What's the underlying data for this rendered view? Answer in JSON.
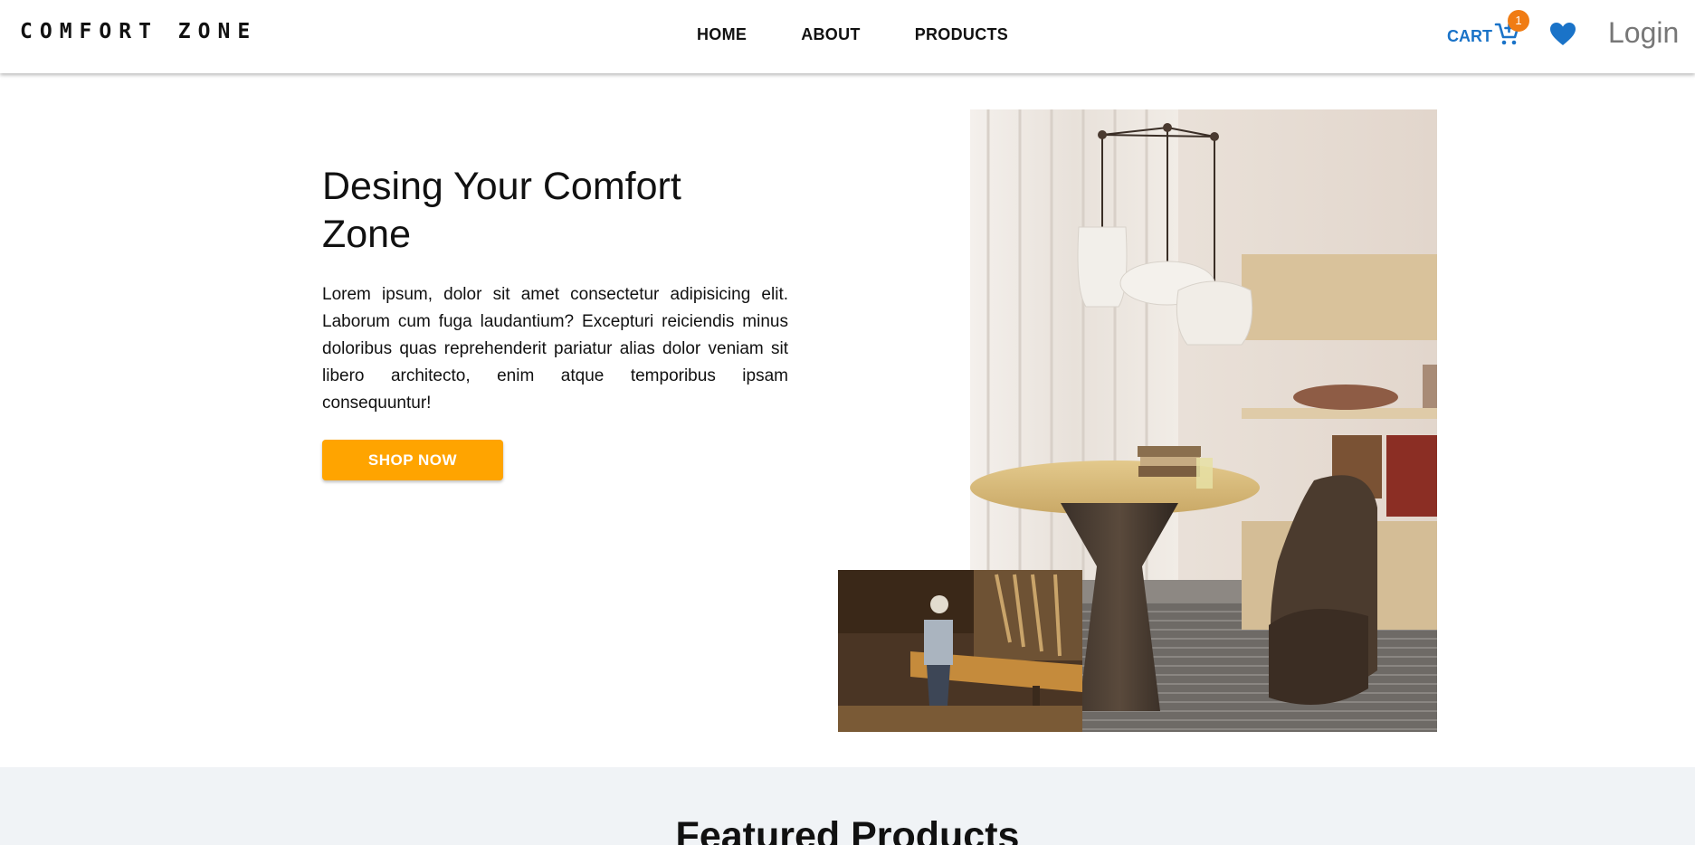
{
  "header": {
    "logo": "COMFORT ZONE",
    "nav": [
      {
        "label": "HOME"
      },
      {
        "label": "ABOUT"
      },
      {
        "label": "PRODUCTS"
      }
    ],
    "cart_label": "CART",
    "cart_icon": "cart-plus-icon",
    "cart_count": "1",
    "wishlist_icon": "heart-icon",
    "login_label": "Login"
  },
  "hero": {
    "title": "Desing Your Comfort Zone",
    "text": "Lorem ipsum, dolor sit amet consectetur adipisicing elit. Laborum cum fuga laudantium? Excepturi reiciendis minus doloribus quas reprehenderit pariatur alias dolor veniam sit libero architecto, enim atque temporibus ipsam consequuntur!",
    "button_label": "SHOP NOW"
  },
  "featured": {
    "title": "Featured Products"
  },
  "colors": {
    "accent_button": "#ffa400",
    "link_blue": "#1a73c8",
    "badge": "#f07c14",
    "section_bg": "#f0f3f6"
  }
}
